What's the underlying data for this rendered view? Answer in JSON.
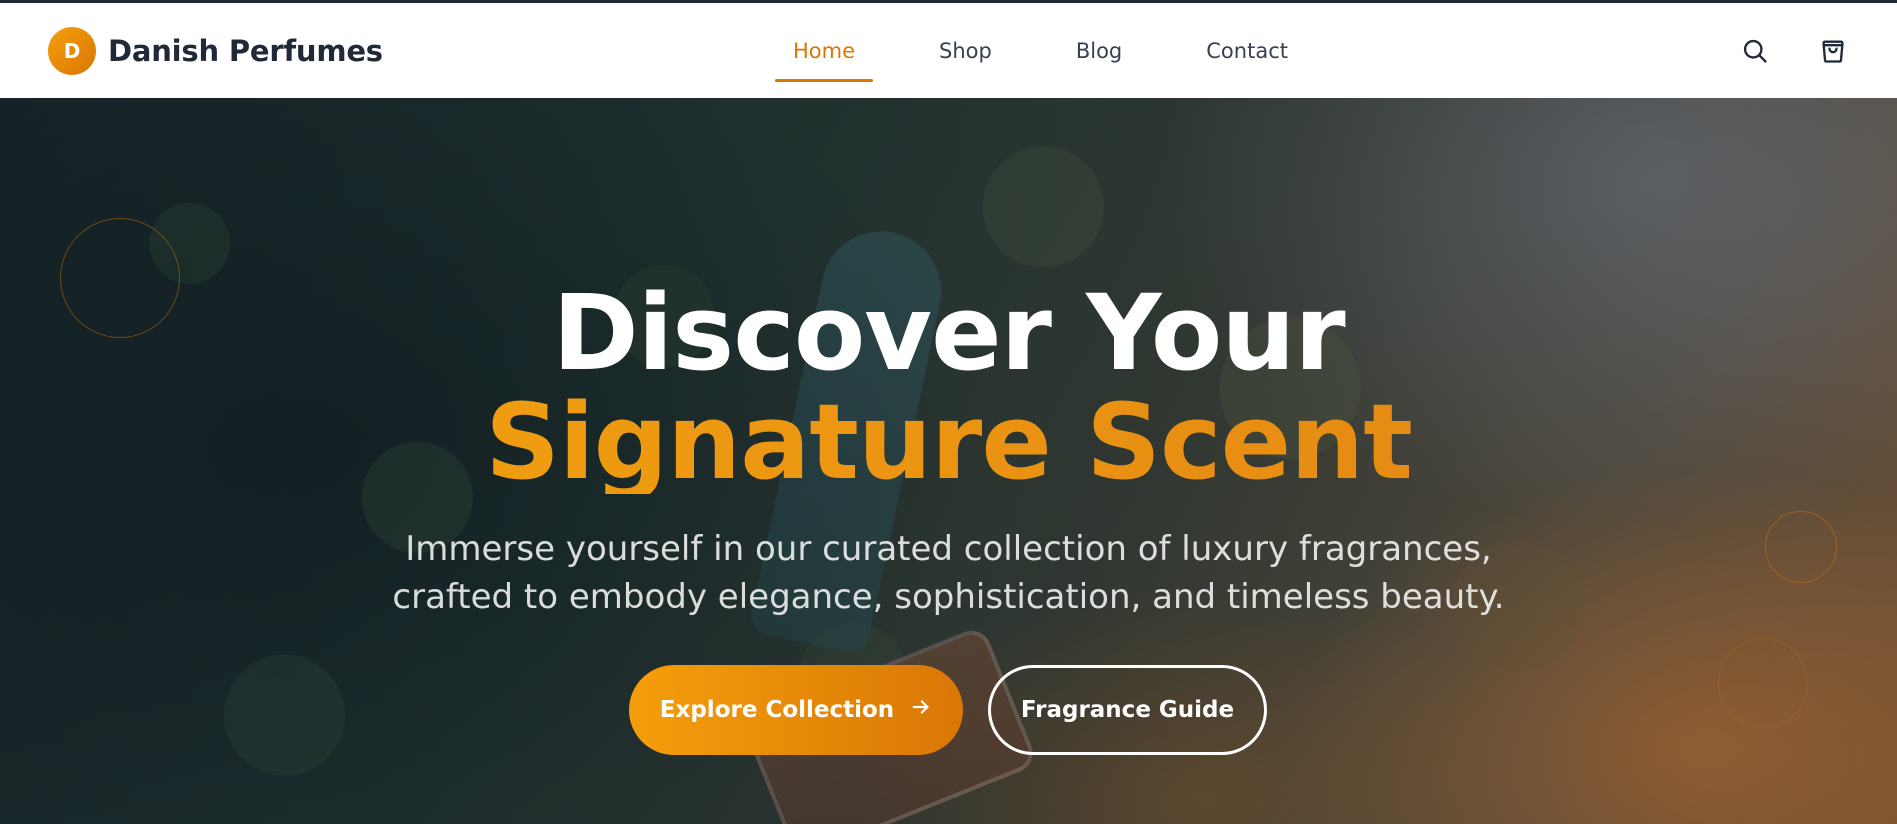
{
  "brand": {
    "logo_letter": "D",
    "name": "Danish Perfumes",
    "accent_color": "#d97706"
  },
  "nav": {
    "items": [
      {
        "label": "Home",
        "active": true
      },
      {
        "label": "Shop",
        "active": false
      },
      {
        "label": "Blog",
        "active": false
      },
      {
        "label": "Contact",
        "active": false
      }
    ]
  },
  "header_icons": [
    "search-icon",
    "shopping-bag-icon"
  ],
  "hero": {
    "title_line1": "Discover Your",
    "title_line2": "Signature Scent",
    "subtitle": "Immerse yourself in our curated collection of luxury fragrances, crafted to embody elegance, sophistication, and timeless beauty.",
    "primary_button": "Explore Collection",
    "primary_button_icon": "arrow-right-icon",
    "secondary_button": "Fragrance Guide"
  }
}
